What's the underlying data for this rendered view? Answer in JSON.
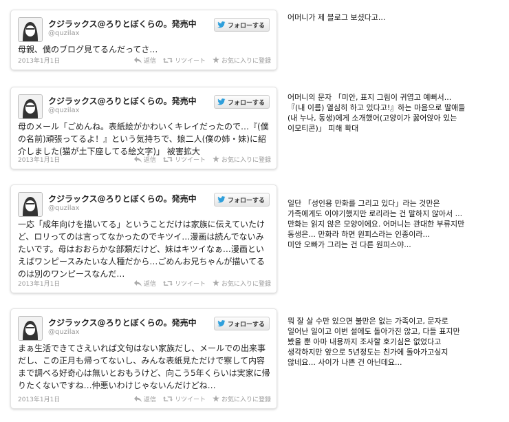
{
  "tweets": [
    {
      "name": "クジラックス@ろりとぼくらの。発売中",
      "handle": "@quzilax",
      "follow_label": "フォローする",
      "text": "母親、僕のブログ見てるんだってさ…",
      "date": "2013年1月1日",
      "reply_label": "返信",
      "retweet_label": "リツイート",
      "favorite_label": "お気に入りに登録"
    },
    {
      "name": "クジラックス@ろりとぼくらの。発売中",
      "handle": "@quzilax",
      "follow_label": "フォローする",
      "text": "母のメール「ごめんね。表紙絵がかわいくキレイだったので…『(僕の名前)頑張ってるよ！』という気持ちで、娘二人(僕の姉・妹)に紹介しました(猫が土下座してる絵文字)」 被害拡大",
      "date": "2013年1月1日",
      "reply_label": "返信",
      "retweet_label": "リツイート",
      "favorite_label": "お気に入りに登録"
    },
    {
      "name": "クジラックス@ろりとぼくらの。発売中",
      "handle": "@quzilax",
      "follow_label": "フォローする",
      "text": "一応「成年向けを描いてる」ということだけは家族に伝えていたけど、ロリってのは言ってなかったのでキツイ…漫画は読んでないみたいです。母はおおらかな部類だけど、妹はキツイなぁ…漫画といえばワンピースみたいな人種だから…ごめんお兄ちゃんが描いてるのは別のワンピースなんだ…",
      "date": "2013年1月1日",
      "reply_label": "返信",
      "retweet_label": "リツイート",
      "favorite_label": "お気に入りに登録"
    },
    {
      "name": "クジラックス@ろりとぼくらの。発売中",
      "handle": "@quzilax",
      "follow_label": "フォローする",
      "text": "まぁ生活できてさえいれば文句はない家族だし、メールでの出来事だし、この正月も帰ってないし、みんな表紙見ただけで察して内容まで調べる好奇心は無いとおもうけど、向こう5年くらいは実家に帰りたくないですね…仲悪いわけじゃないんだけどね…",
      "date": "2013年1月1日",
      "reply_label": "返信",
      "retweet_label": "リツイート",
      "favorite_label": "お気に入りに登録"
    }
  ],
  "notes": [
    "어머니가 제 블로그 보셨다고...",
    "어머니의 문자 「미안, 표지 그림이 귀엽고 예뻐서...\n『(내 이름) 열심히 하고 있다고!』하는 마음으로 딸애들\n(내 누나, 동생)에게 소개했어(고양이가 꿇어앉아 있는\n이모티콘)」 피해 확대",
    "일단 「성인용 만화를 그리고 있다」라는 것만은\n가족에게도 이야기했지만 로리라는 건 말하지 않아서 ...\n만화는 읽지 않은 모양이에요. 어머니는 관대한 부류지만\n동생은... 만화라 하면 원피스라는 인종이라...\n미안 오빠가 그리는 건 다른 원피스야...",
    "뭐 잘 살 수만 있으면 불만은 없는 가족이고, 문자로\n일어난 일이고 이번 설에도 돌아가진 않고, 다들 표지만\n봤을 뿐 아마 내용까지 조사할 호기심은 없었다고\n생각하지만 앞으로 5년정도는 친가에 돌아가고싶지\n않네요... 사이가 나쁜 건 아닌데요..."
  ],
  "colors": {
    "twitter_blue": "#2f9fdb",
    "meta_gray": "#999999"
  }
}
